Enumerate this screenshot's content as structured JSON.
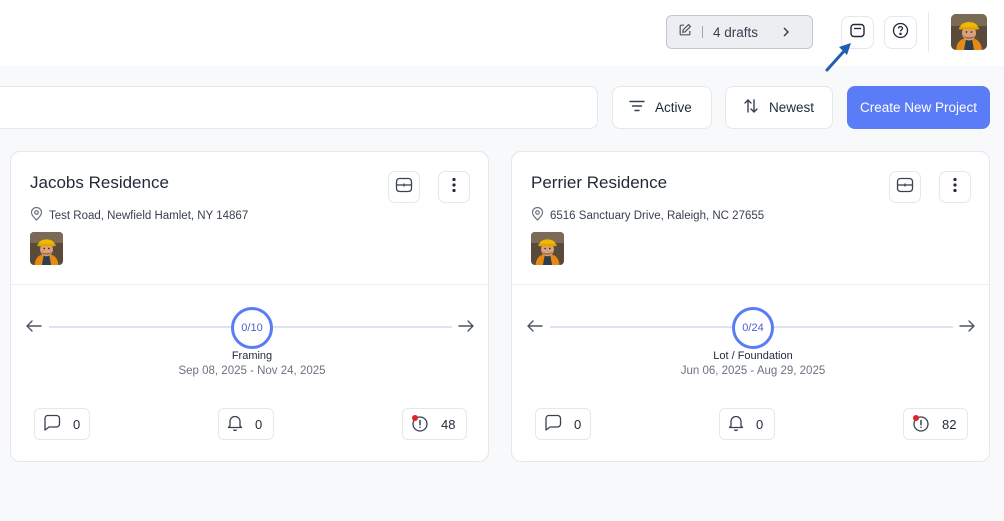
{
  "header": {
    "drafts_label": "4 drafts",
    "icons": {
      "edit": "edit-icon",
      "chevron": "chevron-right-icon",
      "calendar": "calendar-icon",
      "help": "help-icon"
    }
  },
  "toolbar": {
    "search_placeholder": "",
    "filter_label": "Active",
    "sort_label": "Newest",
    "create_label": "Create New Project"
  },
  "colors": {
    "accent": "#5b7cf7",
    "annotation_arrow": "#1f5fb0",
    "alert_dot": "#dc2626"
  },
  "projects": [
    {
      "name": "Jacobs Residence",
      "address": "Test Road, Newfield Hamlet, NY 14867",
      "progress": "0/10",
      "phase": "Framing",
      "dates": "Sep 08, 2025 - Nov 24, 2025",
      "comments": "0",
      "notifications": "0",
      "alerts": "48"
    },
    {
      "name": "Perrier Residence",
      "address": "6516 Sanctuary Drive, Raleigh, NC 27655",
      "progress": "0/24",
      "phase": "Lot / Foundation",
      "dates": "Jun 06, 2025 - Aug 29, 2025",
      "comments": "0",
      "notifications": "0",
      "alerts": "82"
    }
  ]
}
